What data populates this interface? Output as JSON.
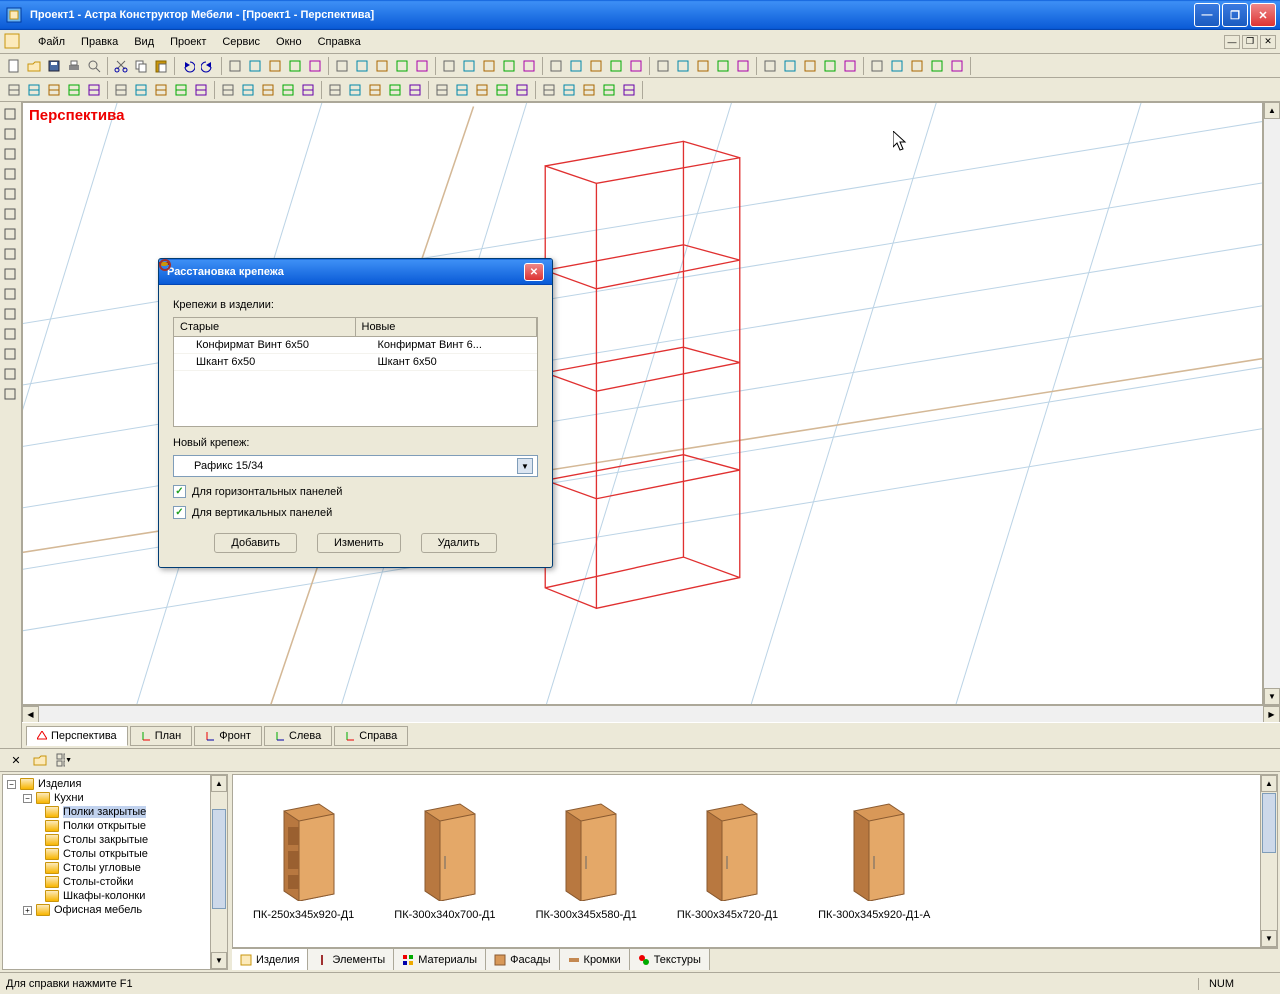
{
  "title": "Проект1 - Астра Конструктор Мебели - [Проект1 - Перспектива]",
  "menu": [
    "Файл",
    "Правка",
    "Вид",
    "Проект",
    "Сервис",
    "Окно",
    "Справка"
  ],
  "viewport_title": "Перспектива",
  "viewTabs": [
    "Перспектива",
    "План",
    "Фронт",
    "Слева",
    "Справа"
  ],
  "dialog": {
    "title": "Расстановка крепежа",
    "section1": "Крепежи в изделии:",
    "col_old": "Старые",
    "col_new": "Новые",
    "rows": [
      {
        "old": "Конфирмат Винт 6x50",
        "new": "Конфирмат Винт 6..."
      },
      {
        "old": "Шкант 6x50",
        "new": "Шкант 6x50"
      }
    ],
    "section2": "Новый крепеж:",
    "combo_value": "Рафикс 15/34",
    "check1": "Для горизонтальных панелей",
    "check2": "Для вертикальных панелей",
    "btn_add": "Добавить",
    "btn_edit": "Изменить",
    "btn_del": "Удалить"
  },
  "tree": {
    "root": "Изделия",
    "kitchens": "Кухни",
    "items": [
      "Полки закрытые",
      "Полки открытые",
      "Столы закрытые",
      "Столы открытые",
      "Столы угловые",
      "Столы-стойки",
      "Шкафы-колонки"
    ],
    "office": "Офисная мебель"
  },
  "thumbs": [
    "ПК-250x345x920-Д1",
    "ПК-300x340x700-Д1",
    "ПК-300x345x580-Д1",
    "ПК-300x345x720-Д1",
    "ПК-300x345x920-Д1-А"
  ],
  "bottomTabs": [
    "Изделия",
    "Элементы",
    "Материалы",
    "Фасады",
    "Кромки",
    "Текстуры"
  ],
  "status": {
    "help": "Для справки нажмите F1",
    "num": "NUM"
  }
}
